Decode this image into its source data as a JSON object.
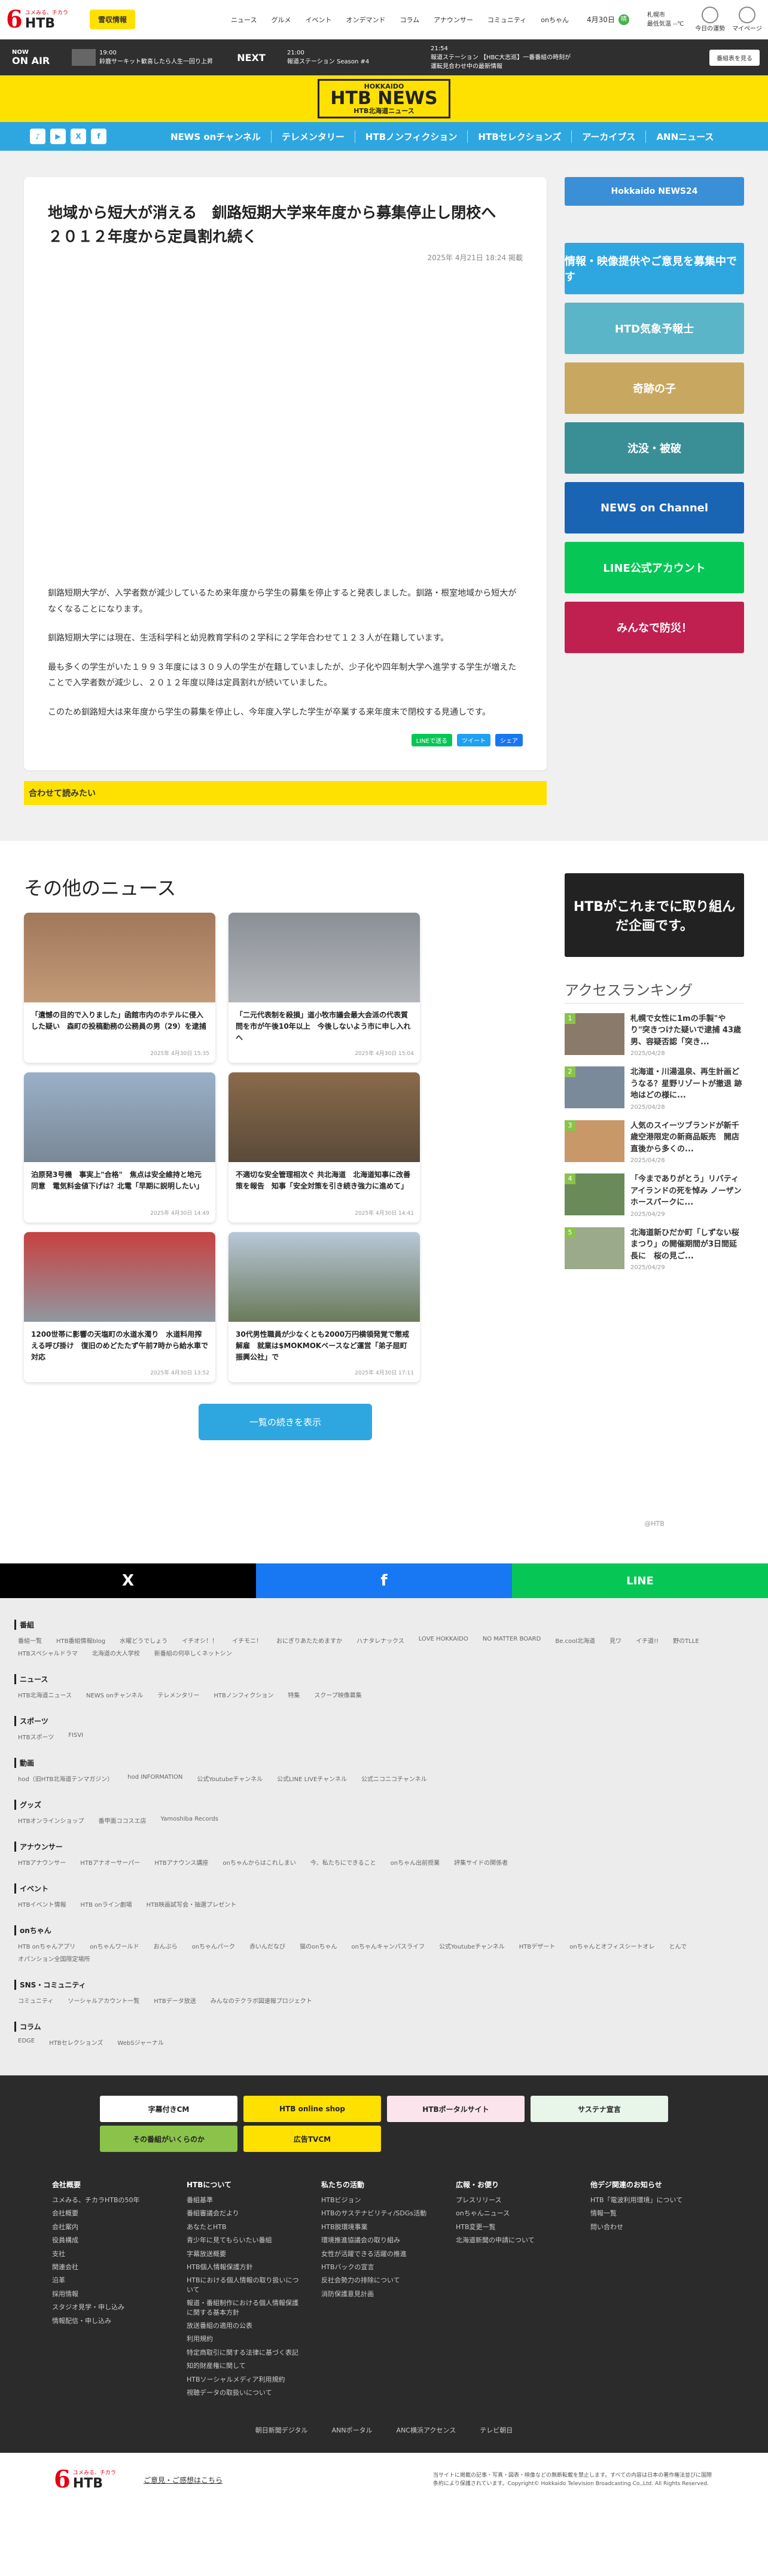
{
  "header": {
    "logo_text": "HTB",
    "logo_sub": "ユメみる、チカラ",
    "quake_label": "雪収情報",
    "nav": [
      "ニュース",
      "グルメ",
      "イベント",
      "オンデマンド",
      "コラム",
      "アナウンサー",
      "コミュニティ",
      "onちゃん"
    ],
    "date": "4月30日",
    "sun_icon": "晴",
    "weather_city": "札幌市",
    "weather_text": "最低気温 --℃",
    "right": [
      "今日の運勢",
      "マイページ"
    ]
  },
  "onair": {
    "label": "ON AIR",
    "now": "NOW",
    "prog1_time": "19:00",
    "prog1_title": "鈴鹿サーキット歓喜したら人生一回り上昇",
    "next": "NEXT",
    "prog2_time": "21:00",
    "prog2_title": "報道ステーション Season #4",
    "prog3_time": "21:54",
    "prog3_title": "報道ステーション 【HBC大志巡】一番番組の時刻が運転見合わせ中の最新情報",
    "button": "番組表を見る"
  },
  "brand": {
    "top": "HOKKAIDO",
    "sub": "HTB北海道ニュース",
    "main": "HTB NEWS"
  },
  "nav": {
    "social": [
      "♪",
      "▶",
      "X",
      "f"
    ],
    "links": [
      "NEWS onチャンネル",
      "テレメンタリー",
      "HTBノンフィクション",
      "HTBセレクションズ",
      "アーカイブス",
      "ANNニュース"
    ]
  },
  "article": {
    "title": "地域から短大が消える　釧路短期大学来年度から募集停止し閉校へ　２０１２年度から定員割れ続く",
    "date": "2025年 4月21日 18:24 掲載",
    "paragraphs": [
      "釧路短期大学が、入学者数が減少しているため来年度から学生の募集を停止すると発表しました。釧路・根室地域から短大がなくなることになります。",
      "釧路短期大学には現在、生活科学科と幼児教育学科の２学科に２学年合わせて１２３人が在籍しています。",
      "最も多くの学生がいた１９９３年度には３０９人の学生が在籍していましたが、少子化や四年制大学へ進学する学生が増えたことで入学者数が減少し、２０１２年度以降は定員割れが続いていました。",
      "このため釧路短大は来年度から学生の募集を停止し、今年度入学した学生が卒業する来年度末で閉校する見通しです。"
    ],
    "share": [
      "LINEで送る",
      "ツイート",
      "シェア"
    ],
    "related": "合わせて読みたい"
  },
  "side_banners": [
    "Hokkaido NEWS24",
    "情報・映像提供やご意見を募集中です",
    "HTD気象予報士",
    "奇跡の子",
    "沈没・被破",
    "NEWS on Channel",
    "LINE公式アカウント",
    "みんなで防災！"
  ],
  "news": {
    "heading": "その他のニュース",
    "items": [
      {
        "title": "「遺憾の目的で入りました」函館市内のホテルに侵入した疑い　森町の投稿勤務の公務員の男（29）を逮捕",
        "date": "2025年 4月30日 15:35"
      },
      {
        "title": "「二元代表制を殺損」道小牧市議会最大会派の代表質問を市が午後10年以上　今後しないよう市に申し入れへ",
        "date": "2025年 4月30日 15:04"
      },
      {
        "title": "泊原発3号機　事実上\"合格\"　焦点は安全維持と地元同意　電気料金値下げは？北電「早期に説明したい」",
        "date": "2025年 4月30日 14:49"
      },
      {
        "title": "不適切な安全管理相次ぐ 共北海道　北海道知事に改善策を報告　知事「安全対策を引き続き強力に進めて」",
        "date": "2025年 4月30日 14:41"
      },
      {
        "title": "1200世帯に影響の天塩町の水道水濁り　水道料用搾える呼び掛け　復旧のめどたたず午前7時から給水車で対応",
        "date": "2025年 4月30日 13:52"
      },
      {
        "title": "30代男性職員が少なくとも2000万円横領発覚で懲戒解雇　就業は$MOKMOKベースなど運営「弟子屈町振興公社」で",
        "date": "2025年 4月30日 17:11"
      }
    ],
    "more": "一覧の続きを表示"
  },
  "promo": "HTBがこれまでに取り組んだ企画です。",
  "ranking": {
    "heading": "アクセスランキング",
    "items": [
      {
        "rank": "1",
        "title": "札幌で女性に1mの手製\"やり\"突きつけた疑いで逮捕 43歳男、容疑否認「突き...",
        "date": "2025/04/28"
      },
      {
        "rank": "2",
        "title": "北海道・川湯温泉、再生計画どうなる？星野リゾートが撤退 跡地はどの様に...",
        "date": "2025/04/28"
      },
      {
        "rank": "3",
        "title": "人気のスイーツブランドが新千歳空港限定の新商品販売　開店直後から多くの...",
        "date": "2025/04/28"
      },
      {
        "rank": "4",
        "title": "「今までありがとう」リバティアイランドの死を悼み ノーザンホースパークに...",
        "date": "2025/04/29"
      },
      {
        "rank": "5",
        "title": "北海道新ひだか町「しずない桜まつり」の開催期間が3日間延長に　桜の見ご...",
        "date": "2025/04/29"
      }
    ],
    "ad": "@HTB"
  },
  "sharebar": [
    "X",
    "f",
    "LINE"
  ],
  "sitemap": [
    {
      "title": "番組",
      "links": [
        "番組一覧",
        "HTB番組情報blog",
        "水曜どうでしょう",
        "イチオシ！！",
        "イチモニ！",
        "おにぎりあたためますか",
        "ハナタレナックス",
        "LOVE HOKKAIDO",
        "NO MATTER BOARD",
        "Be.cool北海道",
        "見ワ",
        "イチ道!!",
        "野のTLLE",
        "HTBスペシャルドラマ",
        "北海道の大人学校",
        "新番組の何卒しくネットシン"
      ]
    },
    {
      "title": "ニュース",
      "links": [
        "HTB北海道ニュース",
        "NEWS onチャンネル",
        "テレメンタリー",
        "HTBノンフィクション",
        "特集",
        "スクープ映像募集"
      ]
    },
    {
      "title": "スポーツ",
      "links": [
        "HTBスポーツ",
        "FISVI"
      ]
    },
    {
      "title": "動画",
      "links": [
        "hod（旧HTB北海道テンマガジン）",
        "hod INFORMATION",
        "公式Youtubeチャンネル",
        "公式LINE LIVEチャンネル",
        "公式ニコニコチャンネル"
      ]
    },
    {
      "title": "グッズ",
      "links": [
        "HTBオンラインショップ",
        "番甲面ココスエ店",
        "Yamoshiba Records"
      ]
    },
    {
      "title": "アナウンサー",
      "links": [
        "HTBアナウンサー",
        "HTBアナオーサーパー",
        "HTBアナウンス講座",
        "onちゃんからはこれしまい",
        "今、私たちにできること",
        "onちゃん出前授業",
        "評集サイドの関係者"
      ]
    },
    {
      "title": "イベント",
      "links": [
        "HTBイベント情報",
        "HTB onライン劇場",
        "HTB映画試写会・抽選プレゼント"
      ]
    },
    {
      "title": "onちゃん",
      "links": [
        "HTB onちゃんアプリ",
        "onちゃんワールド",
        "おんぶら",
        "onちゃんパーク",
        "赤いんだなび",
        "猫のonちゃん",
        "onちゃんキャンパスライフ",
        "公式Youtubeチャンネル",
        "HTBデザート",
        "onちゃんとオフィスシートオレ",
        "とんで",
        "オパンション全国限定場所"
      ]
    },
    {
      "title": "SNS・コミュニティ",
      "links": [
        "コミュニティ",
        "ソーシャルアカウント一覧",
        "HTBデータ放送",
        "みんなのテクラボ図速報プロジェクト"
      ]
    },
    {
      "title": "コラム",
      "links": [
        "EDGE",
        "HTBセレクションズ",
        "WebSジャーナル"
      ]
    }
  ],
  "footer": {
    "banners": [
      "字幕付きCM",
      "HTB online shop",
      "HTBポータルサイト",
      "サステナ宣言",
      "その番組がいくらのか",
      "広告TVCM"
    ],
    "cols": [
      {
        "title": "会社概要",
        "items": [
          "ユメみる、チカラHTBの50年",
          "会社概要",
          "会社案内",
          "役員構成",
          "支社",
          "関連会社",
          "沿革",
          "採用情報",
          "スタジオ見学・申し込み",
          "情報配信・申し込み"
        ]
      },
      {
        "title": "HTBについて",
        "items": [
          "番組基準",
          "番組審議会だより",
          "あなたとHTB",
          "青少年に見てもらいたい番組",
          "字幕放送概要",
          "HTB個人情報保護方針",
          "HTBにおける個人情報の取り扱いについて",
          "報道・番組制作における個人情報保護に関する基本方針",
          "放送番組の適用の公表",
          "利用規約",
          "特定商取引に関する法律に基づく表記",
          "知的財産権に関して",
          "HTBソーシャルメディア利用規約",
          "視聴データの取扱いについて"
        ]
      },
      {
        "title": "私たちの活動",
        "items": [
          "HTBビジョン",
          "HTBのサステナビリティ/SDGs活動",
          "HTB脱環境事業",
          "環境推進協議会の取り組み",
          "女性が活躍できる活躍の推進",
          "HTBバックの宣言",
          "反社会勢力の排除について",
          "消防保護意見計画"
        ]
      },
      {
        "title": "広報・お便り",
        "items": [
          "プレスリリース",
          "onちゃんニュース",
          "HTB変更一覧",
          "北海道新聞の申請について"
        ]
      },
      {
        "title": "他デジ関連のお知らせ",
        "items": [
          "HTB「電波利用環境」について",
          "情報一覧",
          "問い合わせ"
        ]
      }
    ],
    "nav": [
      "朝日新聞デジタル",
      "ANNポータル",
      "ANC横浜アクセンス",
      "テレビ朝日"
    ],
    "contact": "ご意見・ご感想はこちら",
    "copyright": "当サイトに掲載の記事・写真・図表・映像などの無断転載を禁止します。すべての内容は日本の著作権法並びに国際条約により保護されています。Copyright© Hokkaido Television Broadcasting Co.,Ltd. All Rights Reserved."
  },
  "colors": {
    "yellow": "#ffe100",
    "blue": "#2ea7e0",
    "dark": "#2b2b2b",
    "x": "#000000",
    "facebook": "#1877f2",
    "line": "#06c755"
  }
}
